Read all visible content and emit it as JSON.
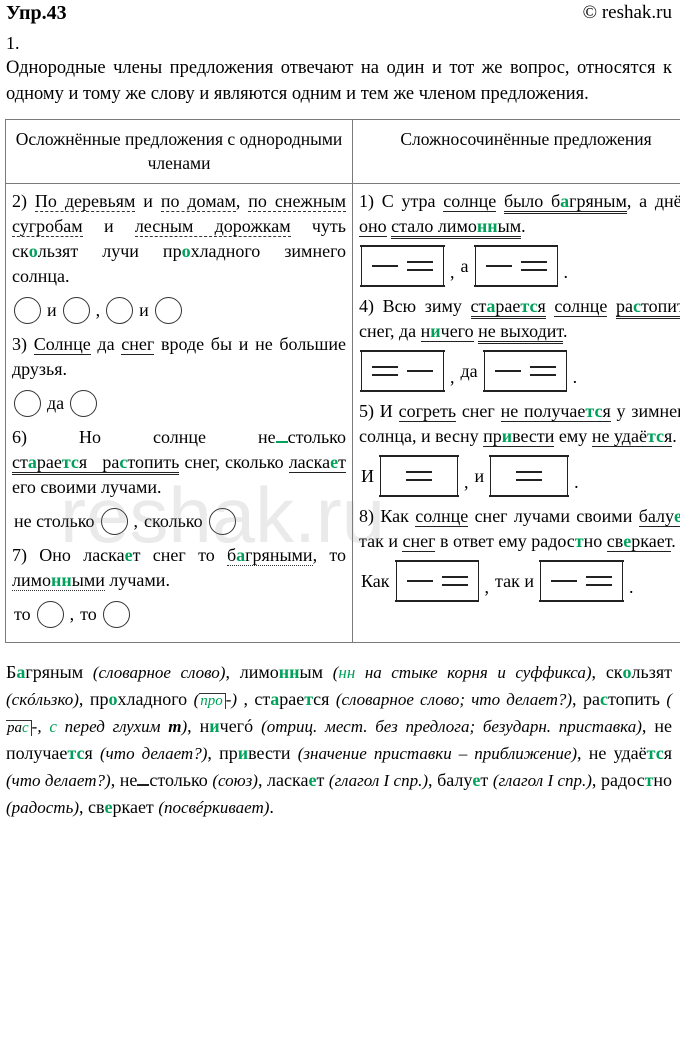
{
  "header": {
    "exercise_title": "Упр.43",
    "copyright": "© reshak.ru"
  },
  "item_number": "1.",
  "intro": "Однородные члены предложения отвечают на один и тот же вопрос, относятся к одному и тому же слову и являются одним и тем же членом предложения.",
  "watermark": "reshak.ru",
  "table": {
    "columns": [
      {
        "header": "Осложнённые предложения с однородными членами"
      },
      {
        "header": "Сложносочинённые предложения"
      }
    ],
    "left_column": {
      "entries": [
        {
          "number": "2)",
          "sentence_plain": "По деревьям и по домам, по снежным сугробам и лесным дорожкам чуть скользят лучи прохладного зимнего солнца.",
          "scheme_type": "circles",
          "scheme_text": "○ и ○, ○ и ○"
        },
        {
          "number": "3)",
          "sentence_plain": "Солнце да снег вроде бы и не большие друзья.",
          "scheme_type": "circles",
          "scheme_text": "○ да ○"
        },
        {
          "number": "6)",
          "sentence_plain": "Но солнце не столько старается растопить снег, сколько ласкает его своими лучами.",
          "scheme_type": "circles",
          "scheme_text": "не столько ○, сколько ○"
        },
        {
          "number": "7)",
          "sentence_plain": "Оно ласкает снег то багряными, то лимонными лучами.",
          "scheme_type": "circles",
          "scheme_text": "то ○, то ○"
        }
      ],
      "conjunctions": {
        "i": "и",
        "da": "да",
        "ne_stolko": "не столько",
        "skolko": "сколько",
        "to": "то",
        "comma": ",",
        "period": "."
      }
    },
    "right_column": {
      "entries": [
        {
          "number": "1)",
          "sentence_plain": "С утра солнце было багряным, а днём оно стало лимонным.",
          "scheme_type": "brackets",
          "scheme_text": "[— =], а [— =]."
        },
        {
          "number": "4)",
          "sentence_plain": "Всю зиму старается солнце растопить снег, да ничего не выходит.",
          "scheme_type": "brackets",
          "scheme_text": "[= —], да [— =]."
        },
        {
          "number": "5)",
          "sentence_plain": "И согреть снег не получается у зимнего солнца, и весну привести ему не удаётся.",
          "scheme_type": "brackets",
          "scheme_text": "И [=], и [=]."
        },
        {
          "number": "8)",
          "sentence_plain": "Как солнце снег лучами своими балует, так и снег в ответ ему радостно сверкает.",
          "scheme_type": "brackets",
          "scheme_text": "Как [— =], так и [— =]."
        }
      ],
      "conjunctions": {
        "a": "а",
        "da": "да",
        "i": "и",
        "i_cap": "И",
        "kak": "Как",
        "tak_i": "так и",
        "comma": ",",
        "period": "."
      }
    }
  },
  "analysis": {
    "items": [
      {
        "word": "Багряным",
        "note": "(словарное слово)"
      },
      {
        "word": "лимонным",
        "note": "(нн на стыке корня и суффикса)"
      },
      {
        "word": "скользят",
        "note": "(скóльзко)"
      },
      {
        "word": "прохладного",
        "note": "(про-)"
      },
      {
        "word": "старается",
        "note": "(словарное слово; что делает?)"
      },
      {
        "word": "растопить",
        "note": "(рас-, с перед глухим т)"
      },
      {
        "word": "ничегó",
        "note": "(отриц. мест. без предлога; безударн. приставка)"
      },
      {
        "word": "не получается",
        "note": "(что делает?)"
      },
      {
        "word": "привести",
        "note": "(значение приставки – приближение)"
      },
      {
        "word": "не удаётся",
        "note": "(что делает?)"
      },
      {
        "word": "не столько",
        "note": "(союз)"
      },
      {
        "word": "ласкает",
        "note": "(глагол I спр.)"
      },
      {
        "word": "балует",
        "note": "(глагол I спр.)"
      },
      {
        "word": "радостно",
        "note": "(радость)"
      },
      {
        "word": "сверкает",
        "note": "(посвéркивает)"
      }
    ]
  },
  "colors": {
    "highlight_green": "#00a15a",
    "table_border": "#7a7a7a",
    "text": "#000000"
  }
}
